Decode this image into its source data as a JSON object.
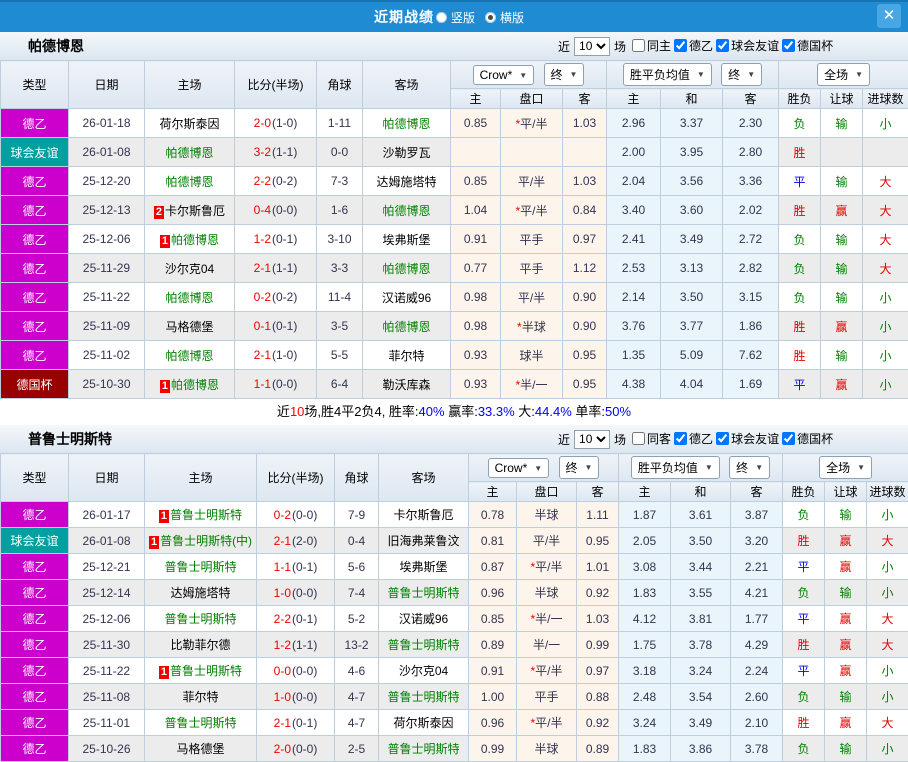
{
  "titlebar": {
    "title": "近期战绩",
    "radios": [
      {
        "label": "竖版",
        "selected": false
      },
      {
        "label": "横版",
        "selected": true
      }
    ],
    "close_glyph": "✕"
  },
  "colors": {
    "titlebar_blue": "#1e8bd2",
    "close_blue": "#49a6e5",
    "focus_team_green": "#008000",
    "score_red": "#f20000",
    "draw_blue": "#0000ee",
    "cream_col": "#fdf5eb",
    "lightblue_col": "#e9f4fb"
  },
  "league_colors": {
    "德乙": "#cc00cc",
    "球会友谊": "#00a0a0",
    "德国杯": "#990000"
  },
  "result_colors": {
    "胜": "#e60000",
    "平": "#0000ee",
    "负": "#008000",
    "赢": "#e60000",
    "输": "#008000",
    "大": "#e60000",
    "小": "#008000"
  },
  "table_header": {
    "cols": [
      "类型",
      "日期",
      "主场",
      "比分(半场)",
      "角球",
      "客场"
    ],
    "odds_select": "Crow*",
    "final_select": "终",
    "avg_select": "胜平负均值",
    "avg_final_select": "终",
    "full_select": "全场",
    "sub_cols": [
      "主",
      "盘口",
      "客",
      "主",
      "和",
      "客",
      "胜负",
      "让球",
      "进球数"
    ]
  },
  "sections": [
    {
      "team": "帕德博恩",
      "filter": {
        "near": "近",
        "count": "10",
        "games": "场",
        "same_label": "同主",
        "same_checked": false,
        "leagues": [
          {
            "label": "德乙",
            "checked": true
          },
          {
            "label": "球会友谊",
            "checked": true
          },
          {
            "label": "德国杯",
            "checked": true
          }
        ]
      },
      "rows": [
        {
          "type": "德乙",
          "date": "26-01-18",
          "home": "荷尔斯泰因",
          "home_green": false,
          "home_rank": "",
          "score": "2-0",
          "half": "(1-0)",
          "corner": "1-11",
          "away": "帕德博恩",
          "away_green": true,
          "away_rank": "",
          "o_home": "0.85",
          "h_star": true,
          "handicap": "平/半",
          "o_away": "1.03",
          "avg": [
            "2.96",
            "3.37",
            "2.30"
          ],
          "res": [
            "负",
            "输",
            "小"
          ]
        },
        {
          "type": "球会友谊",
          "date": "26-01-08",
          "home": "帕德博恩",
          "home_green": true,
          "home_rank": "",
          "score": "3-2",
          "half": "(1-1)",
          "corner": "0-0",
          "away": "沙勒罗瓦",
          "away_green": false,
          "away_rank": "",
          "o_home": "",
          "h_star": false,
          "handicap": "",
          "o_away": "",
          "avg": [
            "2.00",
            "3.95",
            "2.80"
          ],
          "res": [
            "胜",
            "",
            ""
          ]
        },
        {
          "type": "德乙",
          "date": "25-12-20",
          "home": "帕德博恩",
          "home_green": true,
          "home_rank": "",
          "score": "2-2",
          "half": "(0-2)",
          "corner": "7-3",
          "away": "达姆施塔特",
          "away_green": false,
          "away_rank": "",
          "o_home": "0.85",
          "h_star": false,
          "handicap": "平/半",
          "o_away": "1.03",
          "avg": [
            "2.04",
            "3.56",
            "3.36"
          ],
          "res": [
            "平",
            "输",
            "大"
          ]
        },
        {
          "type": "德乙",
          "date": "25-12-13",
          "home": "卡尔斯鲁厄",
          "home_green": false,
          "home_rank": "2",
          "score": "0-4",
          "half": "(0-0)",
          "corner": "1-6",
          "away": "帕德博恩",
          "away_green": true,
          "away_rank": "",
          "o_home": "1.04",
          "h_star": true,
          "handicap": "平/半",
          "o_away": "0.84",
          "avg": [
            "3.40",
            "3.60",
            "2.02"
          ],
          "res": [
            "胜",
            "赢",
            "大"
          ]
        },
        {
          "type": "德乙",
          "date": "25-12-06",
          "home": "帕德博恩",
          "home_green": true,
          "home_rank": "1",
          "score": "1-2",
          "half": "(0-1)",
          "corner": "3-10",
          "away": "埃弗斯堡",
          "away_green": false,
          "away_rank": "",
          "o_home": "0.91",
          "h_star": false,
          "handicap": "平手",
          "o_away": "0.97",
          "avg": [
            "2.41",
            "3.49",
            "2.72"
          ],
          "res": [
            "负",
            "输",
            "大"
          ]
        },
        {
          "type": "德乙",
          "date": "25-11-29",
          "home": "沙尔克04",
          "home_green": false,
          "home_rank": "",
          "score": "2-1",
          "half": "(1-1)",
          "corner": "3-3",
          "away": "帕德博恩",
          "away_green": true,
          "away_rank": "",
          "o_home": "0.77",
          "h_star": false,
          "handicap": "平手",
          "o_away": "1.12",
          "avg": [
            "2.53",
            "3.13",
            "2.82"
          ],
          "res": [
            "负",
            "输",
            "大"
          ]
        },
        {
          "type": "德乙",
          "date": "25-11-22",
          "home": "帕德博恩",
          "home_green": true,
          "home_rank": "",
          "score": "0-2",
          "half": "(0-2)",
          "corner": "11-4",
          "away": "汉诺威96",
          "away_green": false,
          "away_rank": "",
          "o_home": "0.98",
          "h_star": false,
          "handicap": "平/半",
          "o_away": "0.90",
          "avg": [
            "2.14",
            "3.50",
            "3.15"
          ],
          "res": [
            "负",
            "输",
            "小"
          ]
        },
        {
          "type": "德乙",
          "date": "25-11-09",
          "home": "马格德堡",
          "home_green": false,
          "home_rank": "",
          "score": "0-1",
          "half": "(0-1)",
          "corner": "3-5",
          "away": "帕德博恩",
          "away_green": true,
          "away_rank": "",
          "o_home": "0.98",
          "h_star": true,
          "handicap": "半球",
          "o_away": "0.90",
          "avg": [
            "3.76",
            "3.77",
            "1.86"
          ],
          "res": [
            "胜",
            "赢",
            "小"
          ]
        },
        {
          "type": "德乙",
          "date": "25-11-02",
          "home": "帕德博恩",
          "home_green": true,
          "home_rank": "",
          "score": "2-1",
          "half": "(1-0)",
          "corner": "5-5",
          "away": "菲尔特",
          "away_green": false,
          "away_rank": "",
          "o_home": "0.93",
          "h_star": false,
          "handicap": "球半",
          "o_away": "0.95",
          "avg": [
            "1.35",
            "5.09",
            "7.62"
          ],
          "res": [
            "胜",
            "输",
            "小"
          ]
        },
        {
          "type": "德国杯",
          "date": "25-10-30",
          "home": "帕德博恩",
          "home_green": true,
          "home_rank": "1",
          "score": "1-1",
          "half": "(0-0)",
          "corner": "6-4",
          "away": "勒沃库森",
          "away_green": false,
          "away_rank": "",
          "o_home": "0.93",
          "h_star": true,
          "handicap": "半/一",
          "o_away": "0.95",
          "avg": [
            "4.38",
            "4.04",
            "1.69"
          ],
          "res": [
            "平",
            "赢",
            "小"
          ]
        }
      ],
      "summary": [
        {
          "t": "近",
          "c": "k"
        },
        {
          "t": "10",
          "c": "r"
        },
        {
          "t": "场,胜4平2负4, 胜率:",
          "c": "k"
        },
        {
          "t": "40%",
          "c": "b"
        },
        {
          "t": " 赢率:",
          "c": "k"
        },
        {
          "t": "33.3%",
          "c": "b"
        },
        {
          "t": " 大:",
          "c": "k"
        },
        {
          "t": "44.4%",
          "c": "b"
        },
        {
          "t": " 单率:",
          "c": "k"
        },
        {
          "t": "50%",
          "c": "b"
        }
      ]
    },
    {
      "team": "普鲁士明斯特",
      "filter": {
        "near": "近",
        "count": "10",
        "games": "场",
        "same_label": "同客",
        "same_checked": false,
        "leagues": [
          {
            "label": "德乙",
            "checked": true
          },
          {
            "label": "球会友谊",
            "checked": true
          },
          {
            "label": "德国杯",
            "checked": true
          }
        ]
      },
      "rows": [
        {
          "type": "德乙",
          "date": "26-01-17",
          "home": "普鲁士明斯特",
          "home_green": true,
          "home_rank": "1",
          "score": "0-2",
          "half": "(0-0)",
          "corner": "7-9",
          "away": "卡尔斯鲁厄",
          "away_green": false,
          "away_rank": "",
          "o_home": "0.78",
          "h_star": false,
          "handicap": "半球",
          "o_away": "1.11",
          "avg": [
            "1.87",
            "3.61",
            "3.87"
          ],
          "res": [
            "负",
            "输",
            "小"
          ]
        },
        {
          "type": "球会友谊",
          "date": "26-01-08",
          "home": "普鲁士明斯特(中)",
          "home_green": true,
          "home_rank": "1",
          "score": "2-1",
          "half": "(2-0)",
          "corner": "0-4",
          "away": "旧海弗莱鲁汶",
          "away_green": false,
          "away_rank": "",
          "o_home": "0.81",
          "h_star": false,
          "handicap": "平/半",
          "o_away": "0.95",
          "avg": [
            "2.05",
            "3.50",
            "3.20"
          ],
          "res": [
            "胜",
            "赢",
            "大"
          ]
        },
        {
          "type": "德乙",
          "date": "25-12-21",
          "home": "普鲁士明斯特",
          "home_green": true,
          "home_rank": "",
          "score": "1-1",
          "half": "(0-1)",
          "corner": "5-6",
          "away": "埃弗斯堡",
          "away_green": false,
          "away_rank": "",
          "o_home": "0.87",
          "h_star": true,
          "handicap": "平/半",
          "o_away": "1.01",
          "avg": [
            "3.08",
            "3.44",
            "2.21"
          ],
          "res": [
            "平",
            "赢",
            "小"
          ]
        },
        {
          "type": "德乙",
          "date": "25-12-14",
          "home": "达姆施塔特",
          "home_green": false,
          "home_rank": "",
          "score": "1-0",
          "half": "(0-0)",
          "corner": "7-4",
          "away": "普鲁士明斯特",
          "away_green": true,
          "away_rank": "",
          "o_home": "0.96",
          "h_star": false,
          "handicap": "半球",
          "o_away": "0.92",
          "avg": [
            "1.83",
            "3.55",
            "4.21"
          ],
          "res": [
            "负",
            "输",
            "小"
          ]
        },
        {
          "type": "德乙",
          "date": "25-12-06",
          "home": "普鲁士明斯特",
          "home_green": true,
          "home_rank": "",
          "score": "2-2",
          "half": "(0-1)",
          "corner": "5-2",
          "away": "汉诺威96",
          "away_green": false,
          "away_rank": "",
          "o_home": "0.85",
          "h_star": true,
          "handicap": "半/一",
          "o_away": "1.03",
          "avg": [
            "4.12",
            "3.81",
            "1.77"
          ],
          "res": [
            "平",
            "赢",
            "大"
          ]
        },
        {
          "type": "德乙",
          "date": "25-11-30",
          "home": "比勒菲尔德",
          "home_green": false,
          "home_rank": "",
          "score": "1-2",
          "half": "(1-1)",
          "corner": "13-2",
          "away": "普鲁士明斯特",
          "away_green": true,
          "away_rank": "",
          "o_home": "0.89",
          "h_star": false,
          "handicap": "半/一",
          "o_away": "0.99",
          "avg": [
            "1.75",
            "3.78",
            "4.29"
          ],
          "res": [
            "胜",
            "赢",
            "大"
          ]
        },
        {
          "type": "德乙",
          "date": "25-11-22",
          "home": "普鲁士明斯特",
          "home_green": true,
          "home_rank": "1",
          "score": "0-0",
          "half": "(0-0)",
          "corner": "4-6",
          "away": "沙尔克04",
          "away_green": false,
          "away_rank": "",
          "o_home": "0.91",
          "h_star": true,
          "handicap": "平/半",
          "o_away": "0.97",
          "avg": [
            "3.18",
            "3.24",
            "2.24"
          ],
          "res": [
            "平",
            "赢",
            "小"
          ]
        },
        {
          "type": "德乙",
          "date": "25-11-08",
          "home": "菲尔特",
          "home_green": false,
          "home_rank": "",
          "score": "1-0",
          "half": "(0-0)",
          "corner": "4-7",
          "away": "普鲁士明斯特",
          "away_green": true,
          "away_rank": "",
          "o_home": "1.00",
          "h_star": false,
          "handicap": "平手",
          "o_away": "0.88",
          "avg": [
            "2.48",
            "3.54",
            "2.60"
          ],
          "res": [
            "负",
            "输",
            "小"
          ]
        },
        {
          "type": "德乙",
          "date": "25-11-01",
          "home": "普鲁士明斯特",
          "home_green": true,
          "home_rank": "",
          "score": "2-1",
          "half": "(0-1)",
          "corner": "4-7",
          "away": "荷尔斯泰因",
          "away_green": false,
          "away_rank": "",
          "o_home": "0.96",
          "h_star": true,
          "handicap": "平/半",
          "o_away": "0.92",
          "avg": [
            "3.24",
            "3.49",
            "2.10"
          ],
          "res": [
            "胜",
            "赢",
            "大"
          ]
        },
        {
          "type": "德乙",
          "date": "25-10-26",
          "home": "马格德堡",
          "home_green": false,
          "home_rank": "",
          "score": "2-0",
          "half": "(0-0)",
          "corner": "2-5",
          "away": "普鲁士明斯特",
          "away_green": true,
          "away_rank": "",
          "o_home": "0.99",
          "h_star": false,
          "handicap": "半球",
          "o_away": "0.89",
          "avg": [
            "1.83",
            "3.86",
            "3.78"
          ],
          "res": [
            "负",
            "输",
            "小"
          ]
        }
      ],
      "summary": null
    }
  ]
}
